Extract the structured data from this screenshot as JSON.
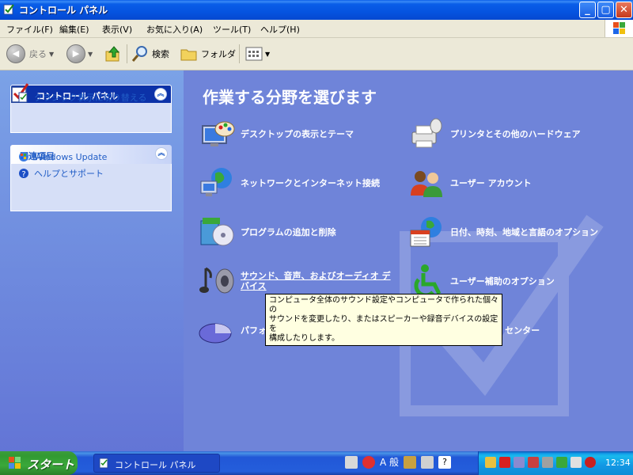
{
  "window": {
    "title": "コントロール パネル",
    "min": "_",
    "max": "▢",
    "close": "✕"
  },
  "menu": [
    "ファイル(F)",
    "編集(E)",
    "表示(V)",
    "お気に入り(A)",
    "ツール(T)",
    "ヘルプ(H)"
  ],
  "toolbar": {
    "back": "戻る",
    "search": "検索",
    "folder": "フォルダ"
  },
  "leftpane": {
    "box1": {
      "title": "コントロール パネル",
      "link": "クラシック表示に切り替える"
    },
    "box2": {
      "title": "関連項目",
      "links": [
        "Windows Update",
        "ヘルプとサポート"
      ]
    }
  },
  "main": {
    "title": "作業する分野を選びます",
    "categories": [
      {
        "label": "デスクトップの表示とテーマ",
        "icon": "desktop-theme-icon"
      },
      {
        "label": "プリンタとその他のハードウェア",
        "icon": "printer-hardware-icon"
      },
      {
        "label": "ネットワークとインターネット接続",
        "icon": "network-icon"
      },
      {
        "label": "ユーザー アカウント",
        "icon": "user-accounts-icon"
      },
      {
        "label": "プログラムの追加と削除",
        "icon": "add-remove-programs-icon"
      },
      {
        "label": "日付、時刻、地域と言語のオプション",
        "icon": "date-time-region-icon"
      },
      {
        "label": "サウンド、音声、およびオーディオ デバイス",
        "icon": "sound-audio-icon"
      },
      {
        "label": "ユーザー補助のオプション",
        "icon": "accessibility-icon"
      },
      {
        "label": "パフォーマンスとメンテナンス",
        "icon": "performance-maintenance-icon"
      },
      {
        "label": "セキュリティ センター",
        "icon": "security-center-icon"
      }
    ]
  },
  "tooltip": {
    "line1": "コンピュータ全体のサウンド設定やコンピュータで作られた個々の",
    "line2": "サウンドを変更したり、またはスピーカーや録音デバイスの設定を",
    "line3": "構成したりします。"
  },
  "taskbar": {
    "start": "スタート",
    "task": "コントロール パネル",
    "ime": "A 般",
    "clock": "12:34"
  },
  "colors": {
    "title_blue": "#0a5ee8",
    "main_bg": "#6f84d9",
    "start_green": "#3aa83a",
    "tooltip_bg": "#ffffe1"
  }
}
